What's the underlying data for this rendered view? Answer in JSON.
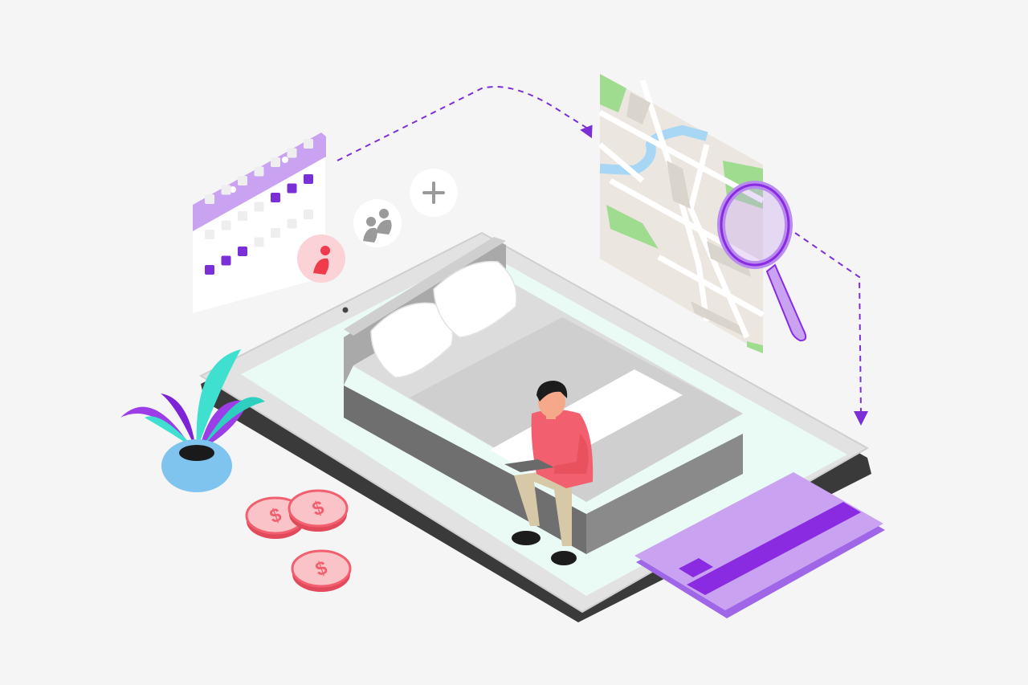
{
  "scene": {
    "subject": "isometric-hotel-booking-illustration"
  },
  "coins": [
    {
      "symbol": "$"
    },
    {
      "symbol": "$"
    },
    {
      "symbol": "$"
    }
  ],
  "icons": {
    "calendar": "calendar-icon",
    "guest_single": "person-icon",
    "guest_group": "group-icon",
    "add": "plus-icon",
    "map": "map-icon",
    "search": "magnifier-icon",
    "card": "credit-card-icon"
  },
  "colors": {
    "background": "#f5f5f5",
    "accent_purple": "#8a2be2",
    "light_purple": "#c9a3f2",
    "coral": "#f25f6f",
    "mint": "#e9fbf4",
    "teal": "#3fe0d0",
    "blue": "#7fc4ef"
  }
}
